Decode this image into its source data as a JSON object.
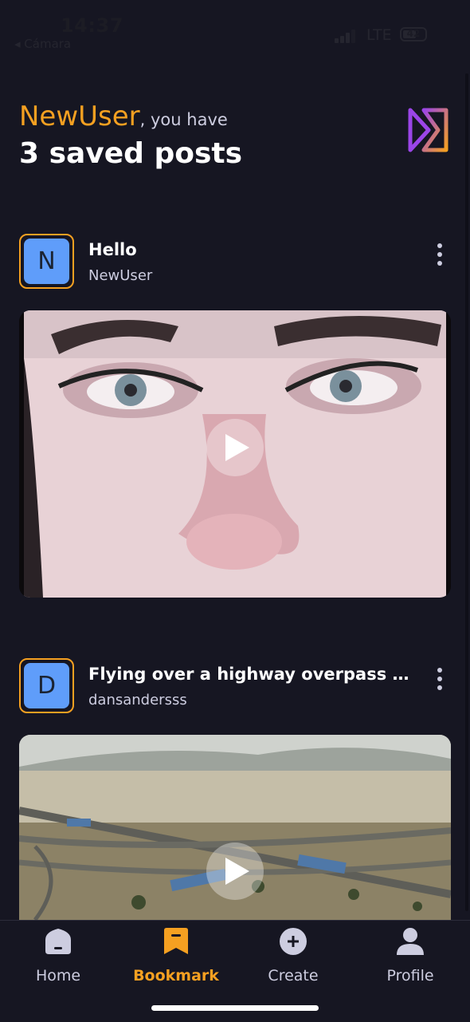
{
  "status_bar": {
    "time": "14:37",
    "back_label": "◂ Cámara",
    "network": "LTE",
    "battery": "42"
  },
  "header": {
    "username": "NewUser",
    "greeting_suffix": ", you have",
    "saved_summary": "3 saved posts"
  },
  "posts": [
    {
      "avatar_letter": "N",
      "title": "Hello",
      "username": "NewUser"
    },
    {
      "avatar_letter": "D",
      "title": "Flying over a highway overpass with...",
      "username": "dansandersss"
    }
  ],
  "nav": {
    "items": [
      {
        "label": "Home",
        "icon": "home-icon",
        "active": false
      },
      {
        "label": "Bookmark",
        "icon": "bookmark-icon",
        "active": true
      },
      {
        "label": "Create",
        "icon": "plus-circle-icon",
        "active": false
      },
      {
        "label": "Profile",
        "icon": "profile-icon",
        "active": false
      }
    ]
  },
  "colors": {
    "background": "#161622",
    "accent": "#f5a021",
    "avatar_bg": "#5f9dfa",
    "muted_text": "#cdcde0"
  }
}
